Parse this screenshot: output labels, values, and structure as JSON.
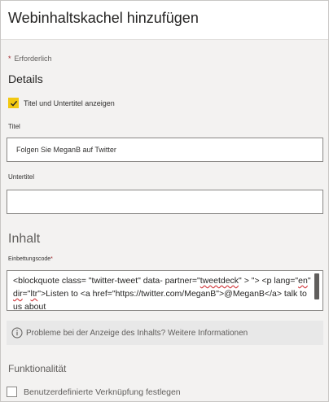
{
  "header": {
    "title": "Webinhaltskachel hinzufügen"
  },
  "required_note": {
    "star": "*",
    "text": "Erforderlich"
  },
  "details": {
    "title": "Details",
    "show_title_checkbox": {
      "label": "Titel und Untertitel anzeigen",
      "checked": true
    },
    "title_field": {
      "label": "Titel",
      "value": "Folgen Sie MeganB auf Twitter"
    },
    "subtitle_field": {
      "label": "Untertitel",
      "value": ""
    }
  },
  "content": {
    "title": "Inhalt",
    "embed_label": "Einbettungscode",
    "embed_required_star": "*",
    "embed_code": {
      "seg1": "<blockquote class= \"twitter-tweet\" data- partner=\"",
      "seg2": "tweetdeck",
      "seg3": "\" > \"> <p lang=\"",
      "seg4": "en",
      "seg5": "\" ",
      "seg6": "dir",
      "seg7": "=\"",
      "seg8": "ltr",
      "seg9": "\">Listen to <a href=\"https://twitter.com/MeganB\">@MeganB</a> talk to us about"
    },
    "info_bar": {
      "icon": "info-icon",
      "text": "Probleme bei der Anzeige des Inhalts? Weitere Informationen"
    }
  },
  "functionality": {
    "title": "Funktionalität",
    "custom_link_checkbox": {
      "label": "Benutzerdefinierte Verknüpfung festlegen",
      "checked": false
    }
  },
  "colors": {
    "checkbox_accent": "#f2c811",
    "required_star": "#a4262c",
    "spellcheck": "#d13438"
  }
}
